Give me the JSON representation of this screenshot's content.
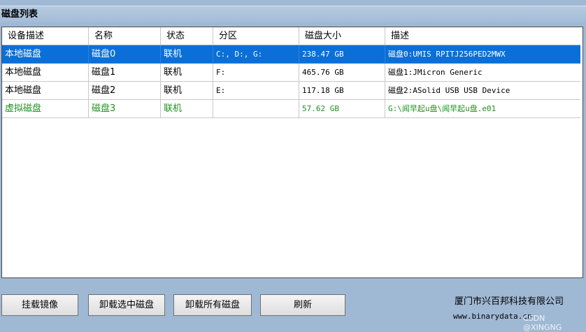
{
  "panel": {
    "title": "磁盘列表"
  },
  "table": {
    "columns": [
      "设备描述",
      "名称",
      "状态",
      "分区",
      "磁盘大小",
      "描述"
    ],
    "rows": [
      [
        "本地磁盘",
        "磁盘0",
        "联机",
        "C:, D:, G:",
        "238.47 GB",
        "磁盘0:UMIS RPITJ256PED2MWX"
      ],
      [
        "本地磁盘",
        "磁盘1",
        "联机",
        "F:",
        "465.76 GB",
        "磁盘1:JMicron Generic"
      ],
      [
        "本地磁盘",
        "磁盘2",
        "联机",
        "E:",
        "117.18 GB",
        "磁盘2:ASolid USB USB Device"
      ],
      [
        "虚拟磁盘",
        "磁盘3",
        "联机",
        "",
        "57.62 GB",
        "G:\\闻早起u盘\\闻早起u盘.e01"
      ]
    ],
    "selected_row": 0,
    "virtual_row_color": "#1f8f1f",
    "selection_color": "#0a6fd8"
  },
  "buttons": {
    "mount": "挂载镜像",
    "unmount_selected": "卸载选中磁盘",
    "unmount_all": "卸载所有磁盘",
    "refresh": "刷新"
  },
  "footer": {
    "company": "厦门市兴百邦科技有限公司",
    "website": "www.binarydata.cn",
    "watermark": "CSDN @XINGNG"
  }
}
